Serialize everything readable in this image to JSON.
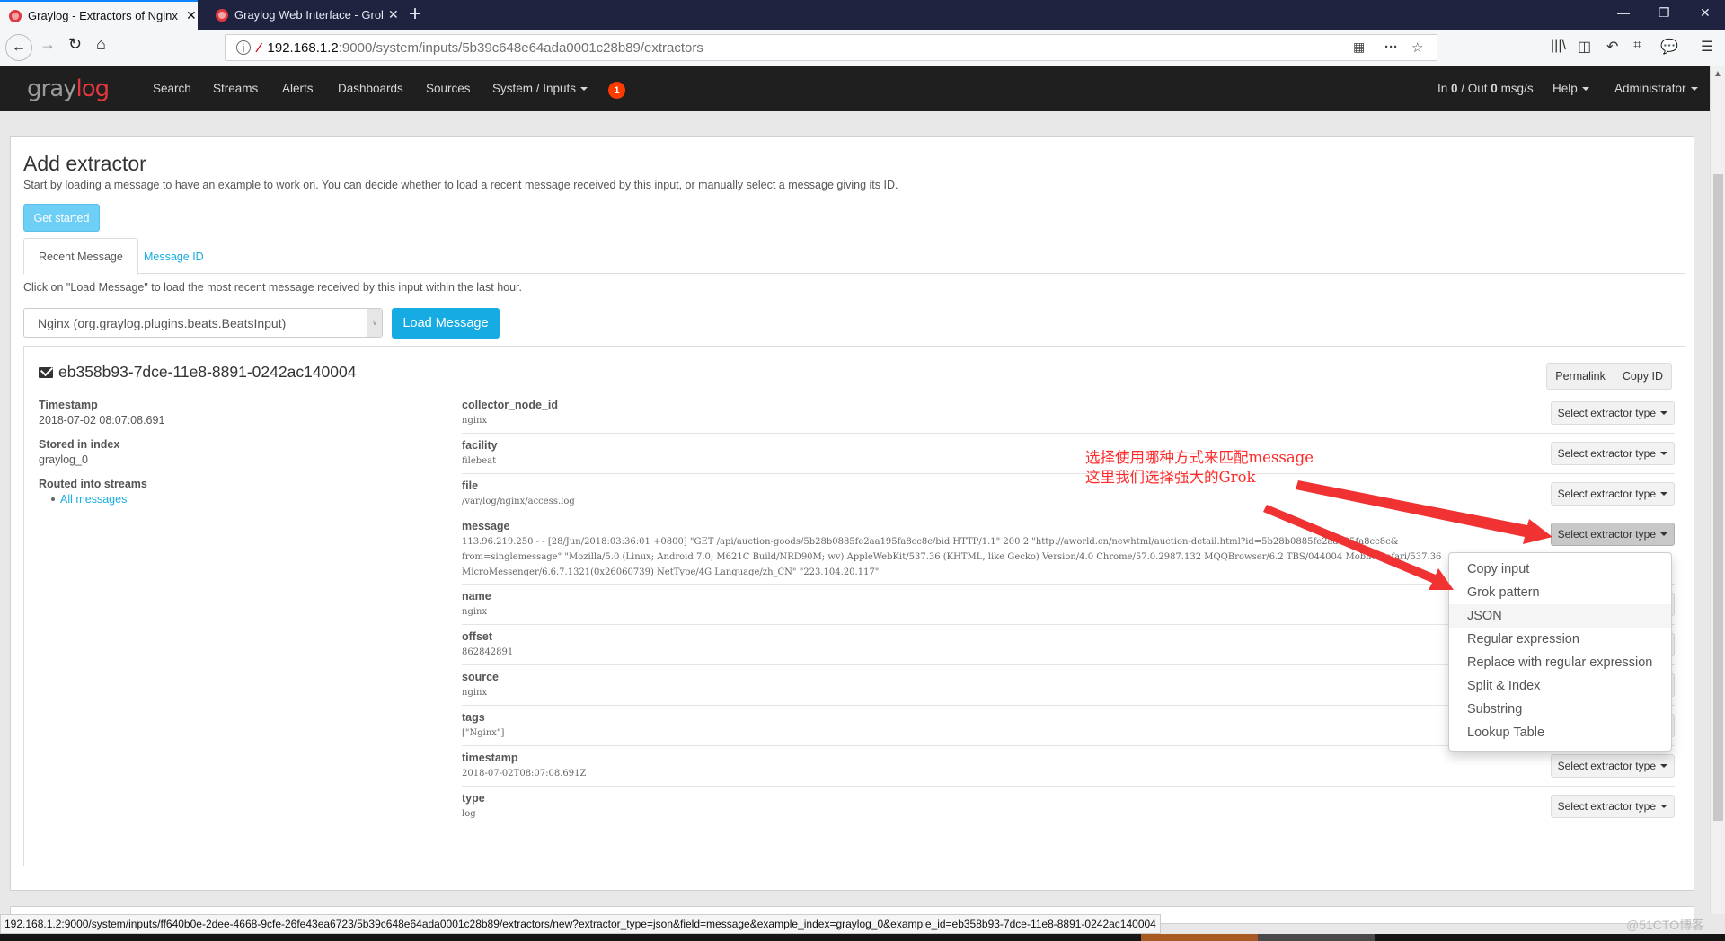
{
  "browser": {
    "tabs": [
      {
        "title": "Graylog - Extractors of Nginx",
        "active": true
      },
      {
        "title": "Graylog Web Interface - Grok",
        "active": false
      }
    ],
    "new_tab_label": "+",
    "url_host": "192.168.1.2",
    "url_path": ":9000/system/inputs/5b39c648e64ada0001c28b89/extractors",
    "status_url": "192.168.1.2:9000/system/inputs/ff640b0e-2dee-4668-9cfe-26fe43ea6723/5b39c648e64ada0001c28b89/extractors/new?extractor_type=json&field=message&example_index=graylog_0&example_id=eb358b93-7dce-11e8-8891-0242ac140004"
  },
  "graylog_nav": {
    "logo_gray": "gray",
    "logo_red": "log",
    "items": [
      "Search",
      "Streams",
      "Alerts",
      "Dashboards",
      "Sources"
    ],
    "system_menu": "System / Inputs",
    "notification_count": "1",
    "throughput_in_label": "In ",
    "throughput_in": "0",
    "throughput_out_label": " / Out ",
    "throughput_out": "0",
    "throughput_unit": " msg/s",
    "help": "Help",
    "user": "Administrator"
  },
  "page": {
    "title": "Add extractor",
    "intro": "Start by loading a message to have an example to work on. You can decide whether to load a recent message received by this input, or manually select a message giving its ID.",
    "get_started": "Get started",
    "tabs": [
      "Recent Message",
      "Message ID"
    ],
    "help_text": "Click on \"Load Message\" to load the most recent message received by this input within the last hour.",
    "input_select": "Nginx (org.graylog.plugins.beats.BeatsInput)",
    "load_button": "Load Message"
  },
  "message": {
    "id": "eb358b93-7dce-11e8-8891-0242ac140004",
    "permalink": "Permalink",
    "copy_id": "Copy ID",
    "meta": {
      "timestamp_label": "Timestamp",
      "timestamp": "2018-07-02 08:07:08.691",
      "index_label": "Stored in index",
      "index": "graylog_0",
      "streams_label": "Routed into streams",
      "stream": "All messages"
    },
    "select_label": "Select extractor type",
    "fields": [
      {
        "key": "collector_node_id",
        "value": "nginx"
      },
      {
        "key": "facility",
        "value": "filebeat"
      },
      {
        "key": "file",
        "value": "/var/log/nginx/access.log"
      },
      {
        "key": "message",
        "value": "113.96.219.250 - - [28/Jun/2018:03:36:01 +0800] \"GET /api/auction-goods/5b28b0885fe2aa195fa8cc8c/bid HTTP/1.1\" 200 2 \"http://aworld.cn/newhtml/auction-detail.html?id=5b28b0885fe2aa195fa8cc8c& from=singlemessage\" \"Mozilla/5.0 (Linux; Android 7.0; M621C Build/NRD90M; wv) AppleWebKit/537.36 (KHTML, like Gecko) Version/4.0 Chrome/57.0.2987.132 MQQBrowser/6.2 TBS/044004 Mobile Safari/537.36 MicroMessenger/6.6.7.1321(0x26060739) NetType/4G Language/zh_CN\" \"223.104.20.117\""
      },
      {
        "key": "name",
        "value": "nginx"
      },
      {
        "key": "offset",
        "value": "862842891"
      },
      {
        "key": "source",
        "value": "nginx"
      },
      {
        "key": "tags",
        "value": "[\"Nginx\"]"
      },
      {
        "key": "timestamp",
        "value": "2018-07-02T08:07:08.691Z"
      },
      {
        "key": "type",
        "value": "log"
      }
    ]
  },
  "dropdown": {
    "items": [
      "Copy input",
      "Grok pattern",
      "JSON",
      "Regular expression",
      "Replace with regular expression",
      "Split & Index",
      "Substring",
      "Lookup Table"
    ],
    "hovered": "JSON"
  },
  "annotation": {
    "line1": "选择使用哪种方式来匹配message",
    "line2": "这里我们选择强大的Grok",
    "color": "#ff2a2a"
  },
  "watermark": "@51CTO博客"
}
